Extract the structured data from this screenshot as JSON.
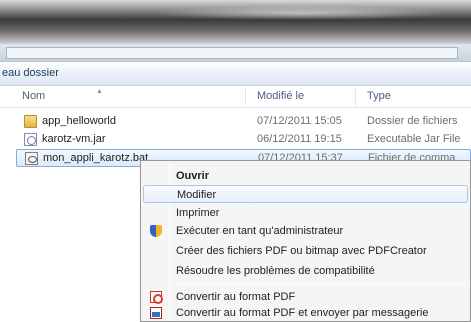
{
  "breadcrumb": {
    "text": "eau dossier"
  },
  "columns": {
    "name": "Nom",
    "modified": "Modifié le",
    "type": "Type"
  },
  "files": [
    {
      "icon": "folder-icon",
      "name": "app_helloworld",
      "modified": "07/12/2011 15:05",
      "type": "Dossier de fichiers"
    },
    {
      "icon": "jar-icon",
      "name": "karotz-vm.jar",
      "modified": "06/12/2011 19:15",
      "type": "Executable Jar File"
    },
    {
      "icon": "bat-icon",
      "name": "mon_appli_karotz.bat",
      "modified": "07/12/2011 15:37",
      "type": "Fichier de comma",
      "selected": true
    }
  ],
  "context_menu": {
    "items": [
      {
        "label": "Ouvrir",
        "bold": true
      },
      {
        "label": "Modifier",
        "highlighted": true
      },
      {
        "label": "Imprimer"
      },
      {
        "label": "Exécuter en tant qu'administrateur",
        "icon": "uac-shield-icon"
      },
      {
        "label": "Créer des fichiers PDF ou bitmap avec PDFCreator"
      },
      {
        "label": "Résoudre les problèmes de compatibilité"
      },
      {
        "label": "Convertir au format PDF",
        "icon": "pdf-convert-icon"
      },
      {
        "label": "Convertir au format PDF et envoyer par messagerie",
        "icon": "pdf-mail-icon"
      }
    ]
  },
  "colors": {
    "selection_border": "#84acdd",
    "menu_background": "#f5f5f5",
    "header_text": "#4c607a"
  }
}
